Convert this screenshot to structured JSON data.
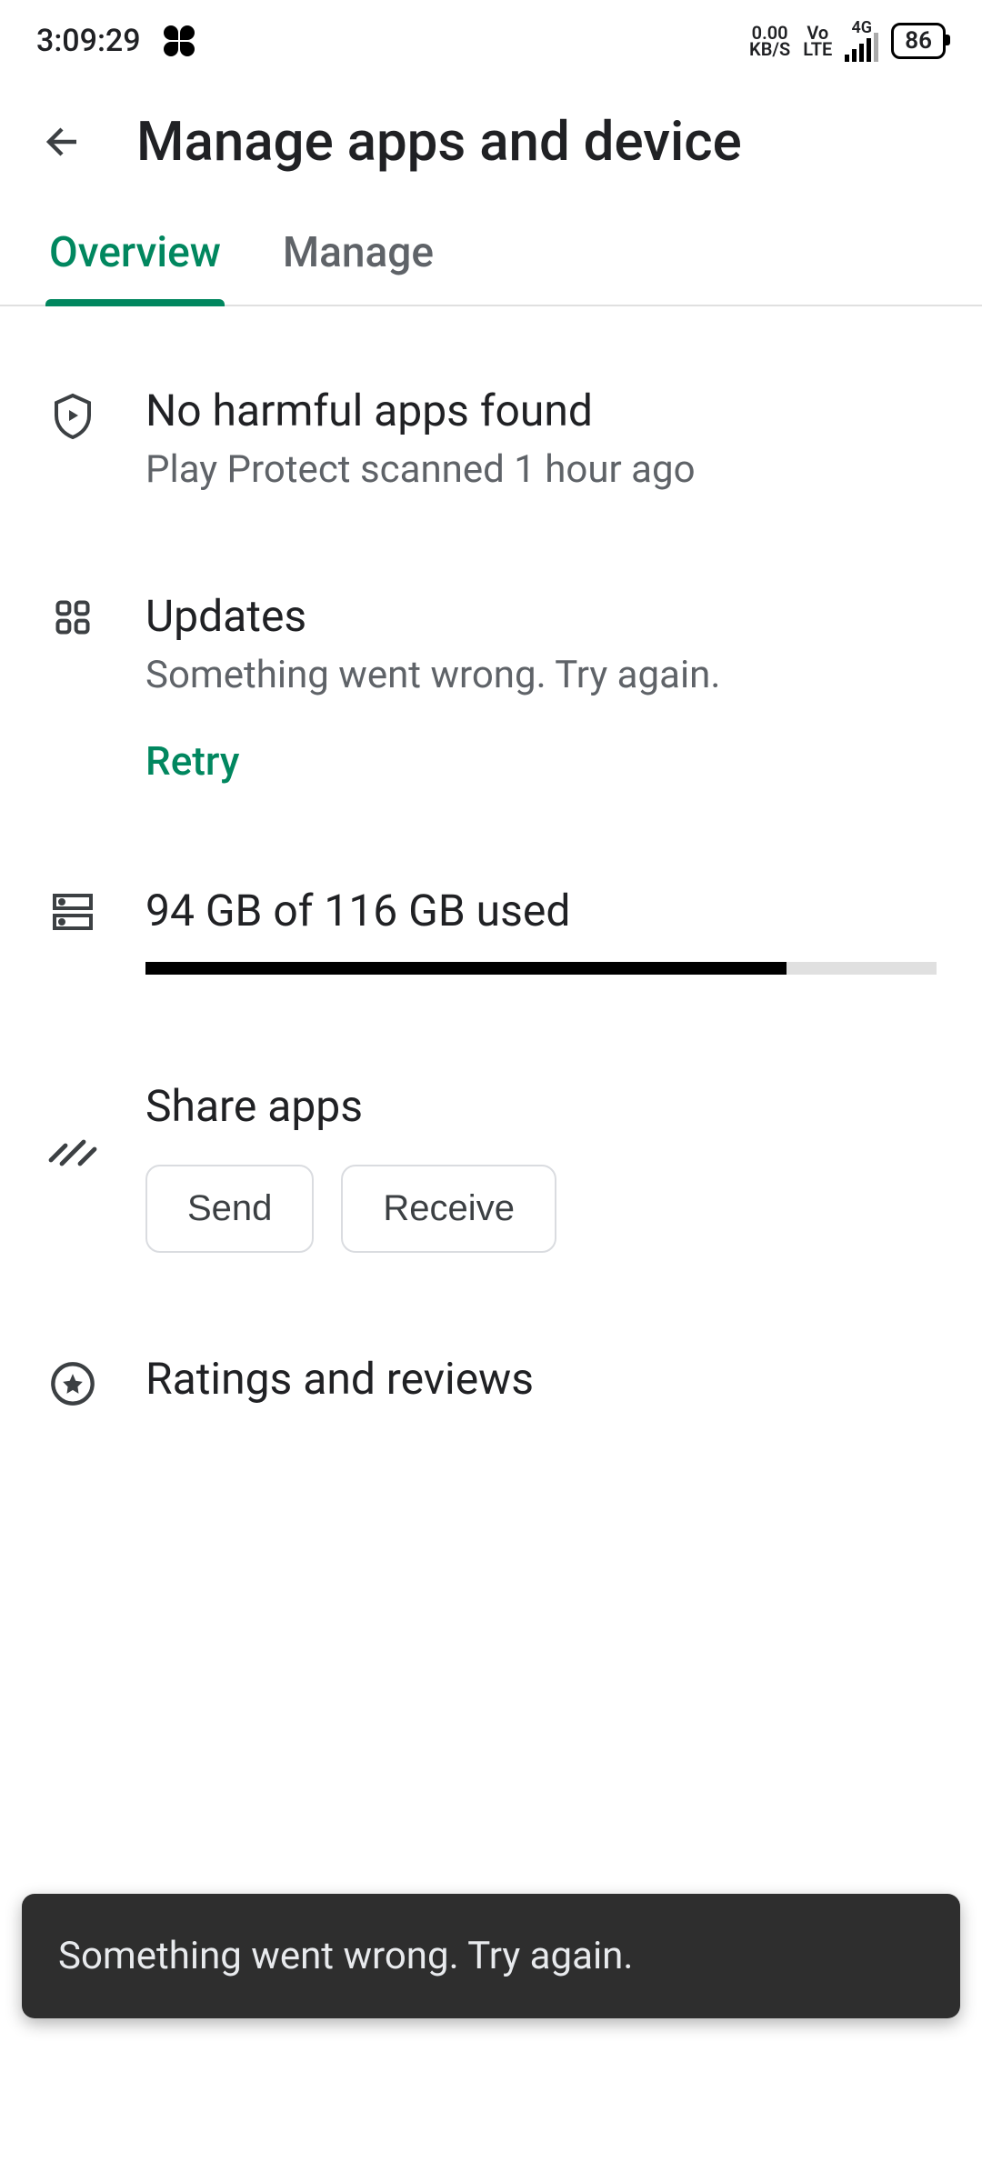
{
  "statusbar": {
    "time": "3:09:29",
    "data_rate_top": "0.00",
    "data_rate_bottom": "KB/S",
    "volte_top": "Vo",
    "volte_bottom": "LTE",
    "net_label": "4G",
    "battery": "86"
  },
  "header": {
    "title": "Manage apps and device"
  },
  "tabs": {
    "overview": "Overview",
    "manage": "Manage"
  },
  "protect": {
    "title": "No harmful apps found",
    "subtitle": "Play Protect scanned 1 hour ago"
  },
  "updates": {
    "title": "Updates",
    "subtitle": "Something went wrong. Try again.",
    "retry": "Retry"
  },
  "storage": {
    "title": "94 GB of 116 GB used",
    "used": 94,
    "total": 116
  },
  "share": {
    "title": "Share apps",
    "send": "Send",
    "receive": "Receive"
  },
  "ratings": {
    "title": "Ratings and reviews"
  },
  "snackbar": {
    "message": "Something went wrong. Try again."
  },
  "colors": {
    "accent": "#01875f"
  }
}
